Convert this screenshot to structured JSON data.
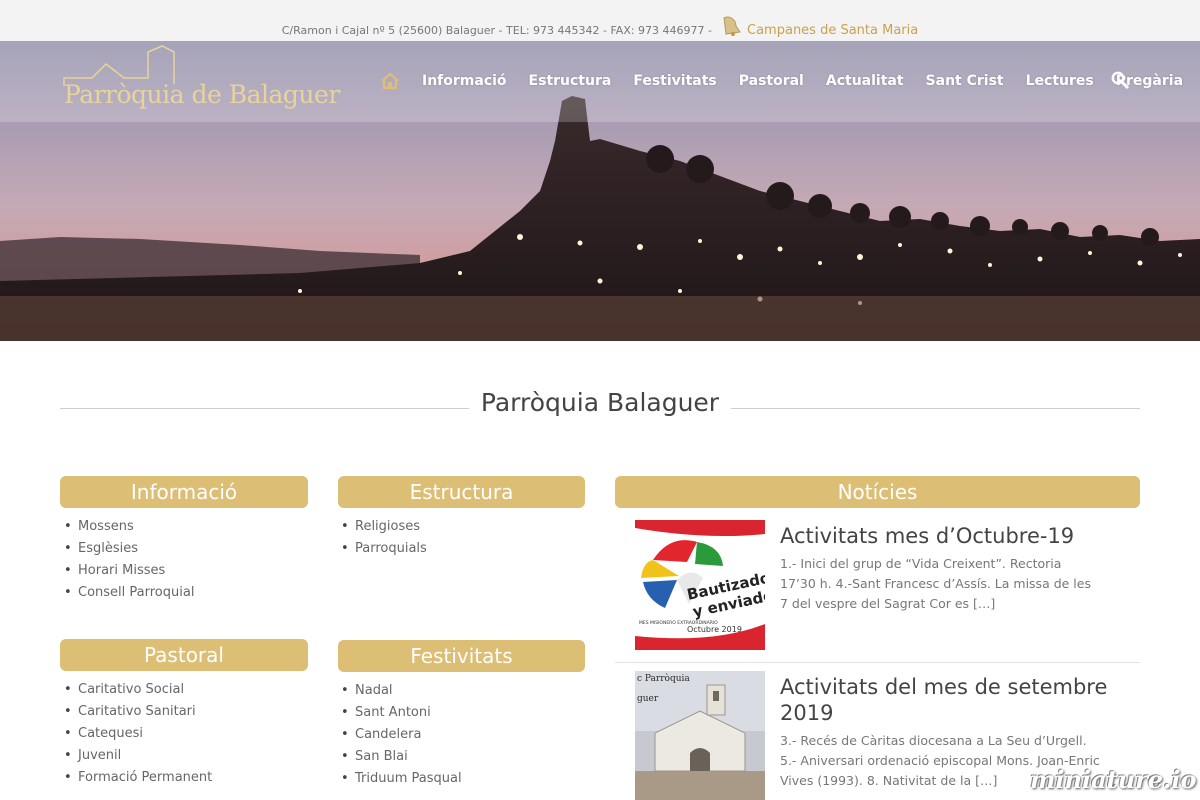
{
  "topbar": {
    "address": "C/Ramon i Cajal nº 5 (25600) Balaguer - TEL: 973 445342 - FAX: 973 446977 -",
    "bells_link": "Campanes de Santa Maria"
  },
  "brand": {
    "logo_text": "Parròquia de Balaguer"
  },
  "nav": {
    "items": [
      "Informació",
      "Estructura",
      "Festivitats",
      "Pastoral",
      "Actualitat",
      "Sant Crist",
      "Lectures",
      "Pregària"
    ]
  },
  "main": {
    "title": "Parròquia Balaguer"
  },
  "boxes": {
    "informacio": {
      "title": "Informació",
      "items": [
        "Mossens",
        "Esglèsies",
        "Horari Misses",
        "Consell Parroquial"
      ]
    },
    "estructura": {
      "title": "Estructura",
      "items": [
        "Religioses",
        "Parroquials"
      ]
    },
    "pastoral": {
      "title": "Pastoral",
      "items": [
        "Caritativo Social",
        "Caritativo Sanitari",
        "Catequesi",
        "Juvenil",
        "Formació Permanent"
      ]
    },
    "festivitats": {
      "title": "Festivitats",
      "items": [
        "Nadal",
        "Sant Antoni",
        "Candelera",
        "San Blai",
        "Triduum Pasqual"
      ]
    }
  },
  "news": {
    "title": "Notícies",
    "items": [
      {
        "title": "Activitats mes d’Octubre-19",
        "excerpt": "1.- Inici  del grup de “Vida Creixent”. Rectoria 17’30 h. 4.-Sant Francesc d’Assís. La missa de les 7 del vespre del Sagrat Cor es […]",
        "thumb_text": {
          "line1": "Bautizados",
          "line2": "y enviados",
          "line3": "MES MISIONERO EXTRAORDINARIO",
          "line4": "Octubre 2019"
        }
      },
      {
        "title": "Activitats del mes de setembre 2019",
        "excerpt": "3.- Recés de Càritas diocesana a La Seu d’Urgell. 5.- Aniversari ordenació episcopal Mons. Joan-Enric Vives (1993). 8. Nativitat de la […]",
        "thumb_text": {
          "line1": "c Parròquia",
          "line2": "guer"
        }
      }
    ]
  },
  "watermark": "miniature.io"
}
